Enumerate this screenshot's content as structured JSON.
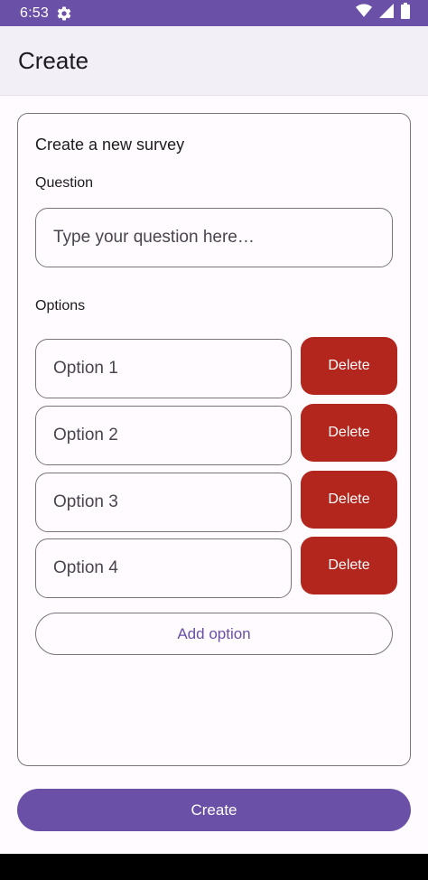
{
  "status_bar": {
    "time": "6:53",
    "icons": [
      "gear-icon",
      "wifi-icon",
      "signal-icon",
      "battery-icon"
    ]
  },
  "app_bar": {
    "title": "Create"
  },
  "card": {
    "title": "Create a new survey",
    "question_label": "Question",
    "question_placeholder": "Type your question here…",
    "options_label": "Options",
    "options": [
      {
        "value": "Option 1",
        "delete_label": "Delete"
      },
      {
        "value": "Option 2",
        "delete_label": "Delete"
      },
      {
        "value": "Option 3",
        "delete_label": "Delete"
      },
      {
        "value": "Option 4",
        "delete_label": "Delete"
      }
    ],
    "add_option_label": "Add option"
  },
  "footer": {
    "create_label": "Create"
  },
  "colors": {
    "primary": "#6a50a6",
    "danger": "#b3261e",
    "app_bar_bg": "#f2eff6",
    "background": "#fffbfe"
  }
}
